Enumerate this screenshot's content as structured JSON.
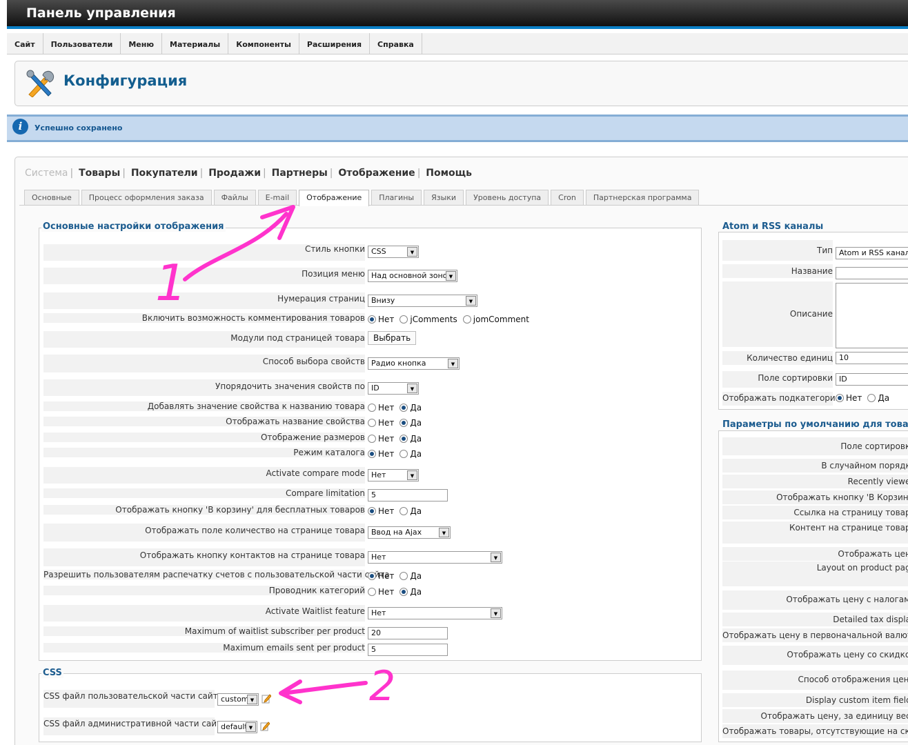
{
  "app_title": "Панель управления",
  "menu": [
    "Сайт",
    "Пользователи",
    "Меню",
    "Материалы",
    "Компоненты",
    "Расширения",
    "Справка"
  ],
  "page_title": "Конфигурация",
  "message": "Успешно сохранено",
  "mainnav": {
    "items": [
      "Система",
      "Товары",
      "Покупатели",
      "Продажи",
      "Партнеры",
      "Отображение",
      "Помощь"
    ]
  },
  "tabs": [
    "Основные",
    "Процесс оформления заказа",
    "Файлы",
    "E-mail",
    "Отображение",
    "Плагины",
    "Языки",
    "Уровень доступа",
    "Cron",
    "Партнерская программа"
  ],
  "display": {
    "legend": "Основные настройки отображения",
    "rows": [
      {
        "label": "Стиль кнопки",
        "select": "CSS"
      },
      {
        "label": "Позиция меню",
        "select": "Над основной зоной"
      },
      {
        "label": "Нумерация страниц",
        "select": "Внизу"
      },
      {
        "label": "Включить возможность комментирования товаров",
        "radios": [
          "Нет",
          "jComments",
          "jomComment"
        ]
      },
      {
        "label": "Модули под страницей товара",
        "button": "Выбрать"
      },
      {
        "label": "Способ выбора свойств",
        "select": "Радио кнопка"
      },
      {
        "label": "Упорядочить значения свойств по",
        "select": "ID"
      },
      {
        "label": "Добавлять значение свойства к названию товара",
        "radios": [
          "Нет",
          "Да"
        ]
      },
      {
        "label": "Отображать название свойства",
        "radios": [
          "Нет",
          "Да"
        ]
      },
      {
        "label": "Отображение размеров",
        "radios": [
          "Нет",
          "Да"
        ]
      },
      {
        "label": "Режим каталога",
        "radios": [
          "Нет",
          "Да"
        ]
      },
      {
        "label": "Activate compare mode",
        "select": "Нет"
      },
      {
        "label": "Compare limitation",
        "input": "5"
      },
      {
        "label": "Отображать кнопку 'В корзину' для бесплатных товаров",
        "radios": [
          "Нет",
          "Да"
        ]
      },
      {
        "label": "Отображать поле количество на странице товара",
        "select": "Ввод на Ajax"
      },
      {
        "label": "Отображать кнопку контактов на странице товара",
        "select": "Нет"
      },
      {
        "label": "Разрешить пользователям распечатку счетов с пользовательской части сайта",
        "radios": [
          "Нет",
          "Да"
        ]
      },
      {
        "label": "Проводник категорий",
        "radios": [
          "Нет",
          "Да"
        ]
      },
      {
        "label": "Activate Waitlist feature",
        "select": "Нет"
      },
      {
        "label": "Maximum of waitlist subscriber per product",
        "input": "20"
      },
      {
        "label": "Maximum emails sent per product",
        "input": "5"
      }
    ]
  },
  "css": {
    "legend": "CSS",
    "rows": [
      {
        "label": "CSS файл пользовательской части сайта",
        "select": "custom"
      },
      {
        "label": "CSS файл административной части сайта",
        "select": "default"
      }
    ]
  },
  "feeds": {
    "legend": "Atom и RSS каналы",
    "rows": [
      {
        "label": "Тип",
        "value": "Atom и RSS каналы"
      },
      {
        "label": "Название",
        "value": ""
      },
      {
        "label": "Описание",
        "value": ""
      },
      {
        "label": "Количество единиц",
        "value": "10"
      },
      {
        "label": "Поле сортировки",
        "value": "ID"
      },
      {
        "label": "Отображать подкатегории",
        "radios": [
          "Нет",
          "Да"
        ]
      }
    ]
  },
  "defaults": {
    "legend": "Параметры по умолчанию для товаров",
    "labels": [
      "Поле сортировки",
      "В случайном порядке",
      "Recently viewed",
      "Отображать кнопку 'В Корзину'",
      "Ссылка на страницу товара",
      "Контент на странице товара",
      "Отображать цену",
      "Layout on product page",
      "Отображать цену с налогами",
      "Detailed tax display",
      "Отображать цену в первоначальной валюте",
      "Отображать цену со скидкой",
      "Способ отображения цены",
      "Display custom item fields",
      "Отображать цену, за единицу веса",
      "Отображать товары, отсутствующие на складе"
    ]
  },
  "annotations": {
    "one": "1",
    "two": "2",
    "color": "#ff33cc"
  }
}
